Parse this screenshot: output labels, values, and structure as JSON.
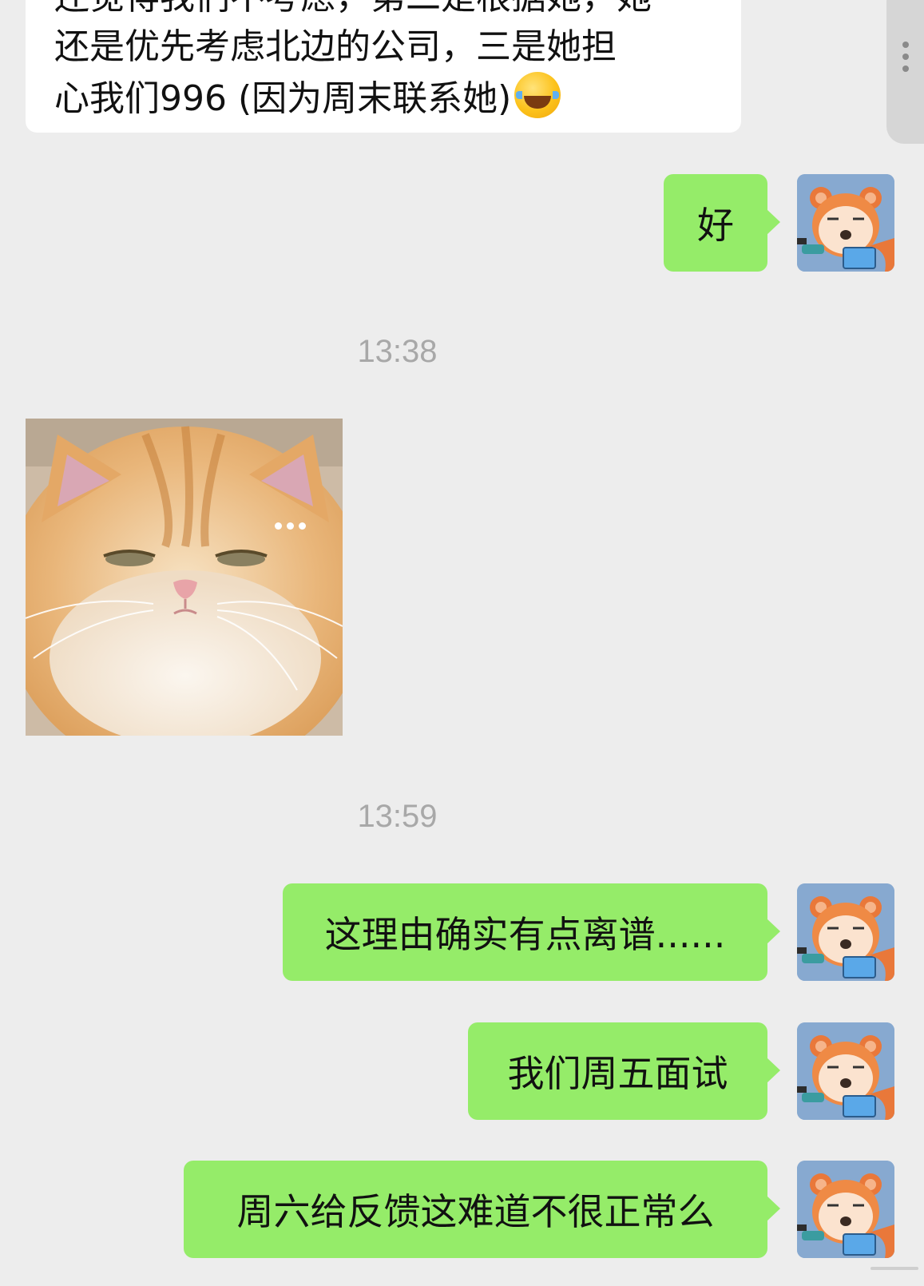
{
  "incoming_message": {
    "line_cut": "还觉得我们不考虑，第二是根据她，她",
    "line_2": "还是优先考虑北边的公司，三是她担",
    "line_3": "心我们996 (因为周末联系她)",
    "emoji": "laughing-tears-emoji"
  },
  "messages": {
    "msg_hao": "好",
    "msg_lipu": "这理由确实有点离谱......",
    "msg_friday": "我们周五面试",
    "msg_saturday": "周六给反馈这难道不很正常么"
  },
  "timestamps": {
    "t1": "13:38",
    "t2": "13:59"
  },
  "colors": {
    "background": "#ededed",
    "incoming_bubble": "#ffffff",
    "outgoing_bubble": "#95ec69",
    "timestamp_text": "#a8a8a8",
    "avatar_bg": "#87a9d0"
  },
  "icons": {
    "avatar": "raccoon-avatar-icon",
    "sticker": "cat-sticker-image",
    "more": "more-dots-icon"
  }
}
